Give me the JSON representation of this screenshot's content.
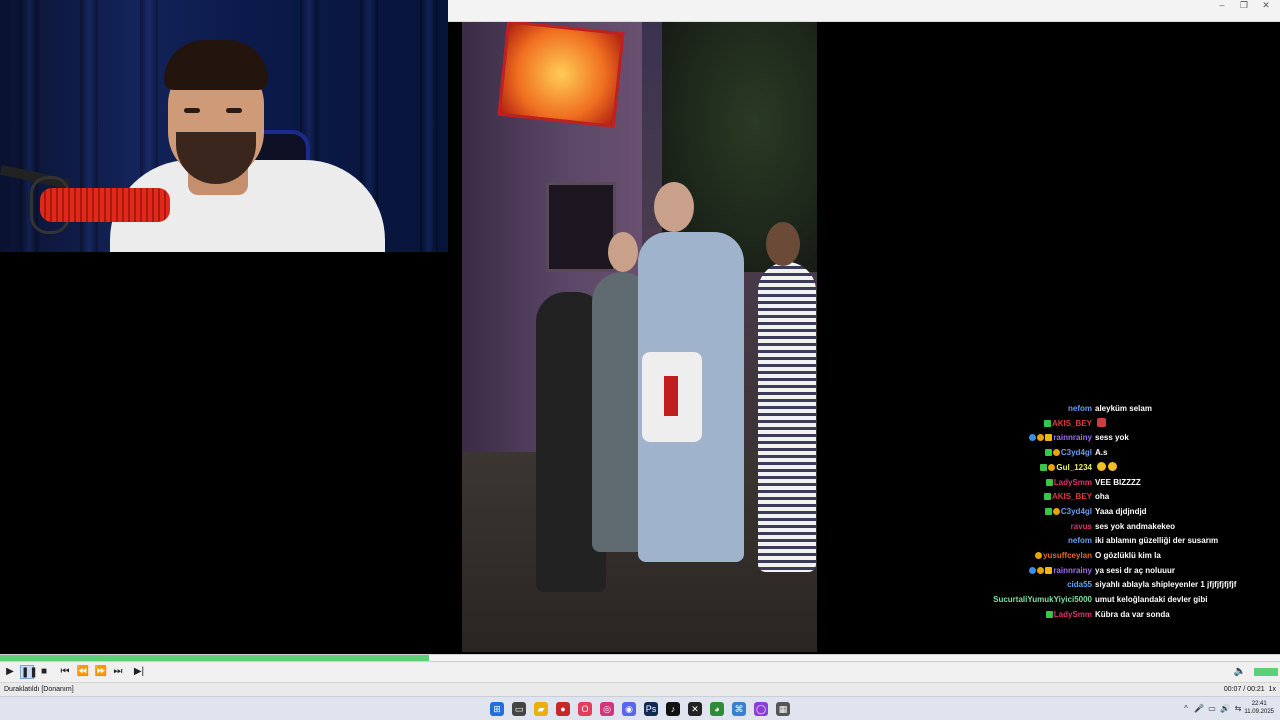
{
  "window": {
    "controls": {
      "minimize": "–",
      "maximize": "❐",
      "close": "✕"
    }
  },
  "chat": [
    {
      "user": "nefom",
      "color": "#6b9cf0",
      "badges": [],
      "message": "aleyküm selam",
      "emoji": ""
    },
    {
      "user": "AKIS_BEY",
      "color": "#d83a3a",
      "badges": [
        "plus"
      ],
      "message": "",
      "emoji": "red"
    },
    {
      "user": "rainnrainy",
      "color": "#a06ef0",
      "badges": [
        "blue",
        "gold",
        "crown"
      ],
      "message": "sess yok",
      "emoji": ""
    },
    {
      "user": "C3yd4gl",
      "color": "#6b9cf0",
      "badges": [
        "plus",
        "gold"
      ],
      "message": "A.s",
      "emoji": ""
    },
    {
      "user": "Gul_1234",
      "color": "#e8f060",
      "badges": [
        "plus",
        "gold"
      ],
      "message": "",
      "emoji": "double"
    },
    {
      "user": "LadySmm",
      "color": "#e0306e",
      "badges": [
        "plus"
      ],
      "message": "VEE BIZZZZ",
      "emoji": ""
    },
    {
      "user": "AKIS_BEY",
      "color": "#d83a3a",
      "badges": [
        "plus"
      ],
      "message": "oha",
      "emoji": ""
    },
    {
      "user": "C3yd4gl",
      "color": "#6b9cf0",
      "badges": [
        "plus",
        "gold"
      ],
      "message": "Yaaa djdjndjd",
      "emoji": ""
    },
    {
      "user": "ravus",
      "color": "#e0306e",
      "badges": [],
      "message": "ses yok andmakekeo",
      "emoji": ""
    },
    {
      "user": "nefom",
      "color": "#6b9cf0",
      "badges": [],
      "message": "iki ablamın güzelliği der susarım",
      "emoji": ""
    },
    {
      "user": "yusuffceylan",
      "color": "#e06a2a",
      "badges": [
        "gold"
      ],
      "message": "O gözlüklü kim la",
      "emoji": ""
    },
    {
      "user": "rainnrainy",
      "color": "#a06ef0",
      "badges": [
        "blue",
        "gold",
        "crown"
      ],
      "message": "ya sesi dr aç noluuur",
      "emoji": ""
    },
    {
      "user": "cida55",
      "color": "#5aa8f0",
      "badges": [],
      "message": "siyahlı ablayla shipleyenler 1 jfjfjfjfjfjf",
      "emoji": ""
    },
    {
      "user": "SucurtaliYumukYiyici5000",
      "color": "#7fe0a0",
      "badges": [],
      "message": "umut keloğlandaki devler gibi",
      "emoji": ""
    },
    {
      "user": "LadySmm",
      "color": "#e0306e",
      "badges": [
        "plus"
      ],
      "message": "Kübra da var sonda",
      "emoji": ""
    }
  ],
  "player": {
    "progress_fraction": 0.335,
    "volume_fraction": 1.0,
    "status_left": "Duraklatıldı [Donanım]",
    "time": "00:07 / 00:21",
    "speed": "1x",
    "buttons": {
      "play": "▶",
      "pause": "❚❚",
      "stop": "■",
      "prev": "⏮",
      "rewind": "⏪",
      "forward": "⏩",
      "next": "⏭",
      "frame_step": "▶|",
      "volume": "🔈"
    }
  },
  "taskbar": {
    "clock_time": "22:41",
    "clock_date": "11.09.2025",
    "apps": [
      {
        "name": "start",
        "glyph": "⊞",
        "color": "#1f6fe0"
      },
      {
        "name": "task-view",
        "glyph": "▭",
        "color": "#444"
      },
      {
        "name": "file-explorer",
        "glyph": "▰",
        "color": "#e7b10a"
      },
      {
        "name": "app-red",
        "glyph": "●",
        "color": "#c62828"
      },
      {
        "name": "opera",
        "glyph": "O",
        "color": "#e53e5a"
      },
      {
        "name": "instagram",
        "glyph": "◎",
        "color": "#d2367a"
      },
      {
        "name": "discord",
        "glyph": "◉",
        "color": "#5865f2"
      },
      {
        "name": "photoshop",
        "glyph": "Ps",
        "color": "#0f2a55"
      },
      {
        "name": "tiktok",
        "glyph": "♪",
        "color": "#111"
      },
      {
        "name": "capcut",
        "glyph": "✕",
        "color": "#222"
      },
      {
        "name": "chrome",
        "glyph": "◕",
        "color": "#2e8b3a"
      },
      {
        "name": "network",
        "glyph": "⌘",
        "color": "#3a7fd0"
      },
      {
        "name": "app-purple",
        "glyph": "◯",
        "color": "#8a3fd6"
      },
      {
        "name": "media-player",
        "glyph": "▦",
        "color": "#555"
      }
    ],
    "tray": [
      "^",
      "🎤",
      "▭",
      "🔊",
      "⇆"
    ]
  }
}
